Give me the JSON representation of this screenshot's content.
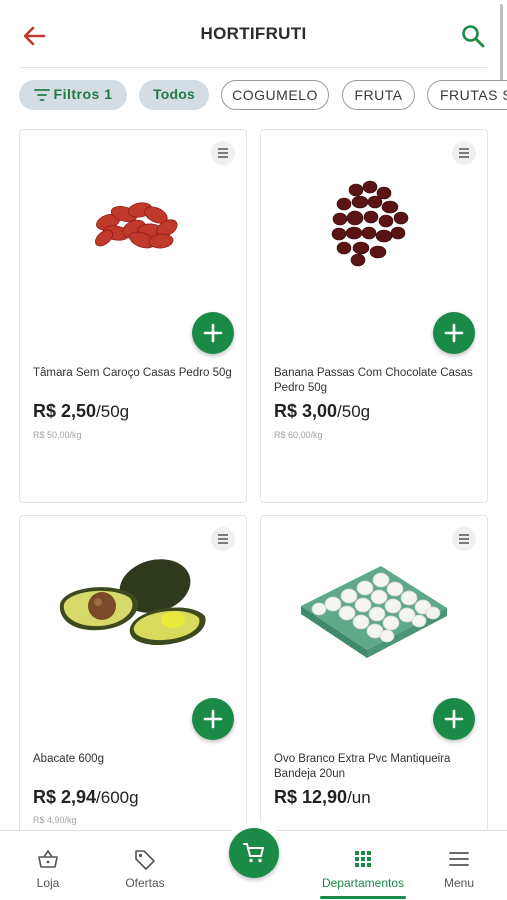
{
  "header": {
    "title": "HORTIFRUTI",
    "back_icon": "arrow-left-icon",
    "search_icon": "search-icon"
  },
  "filters": {
    "filter_label": "Filtros",
    "filter_count": "1",
    "chips": [
      "Todos",
      "COGUMELO",
      "FRUTA",
      "FRUTAS S"
    ]
  },
  "products": [
    {
      "name": "Tâmara Sem Caroço Casas Pedro 50g",
      "price": "R$ 2,50",
      "unit": "/50g",
      "unit_price": "R$ 50,00/kg",
      "image": "dates-image"
    },
    {
      "name": "Banana Passas Com Chocolate Casas Pedro 50g",
      "price": "R$ 3,00",
      "unit": "/50g",
      "unit_price": "R$ 60,00/kg",
      "image": "chocolate-banana-image"
    },
    {
      "name": "Abacate 600g",
      "price": "R$ 2,94",
      "unit": "/600g",
      "unit_price": "R$ 4,90/kg",
      "image": "avocado-image"
    },
    {
      "name": "Ovo Branco Extra Pvc Mantiqueira Bandeja 20un",
      "price": "R$ 12,90",
      "unit": "/un",
      "unit_price": "",
      "image": "eggs-tray-image"
    }
  ],
  "bottom_nav": {
    "items": [
      {
        "label": "Loja",
        "icon": "basket-icon"
      },
      {
        "label": "Ofertas",
        "icon": "tag-icon"
      },
      {
        "label": "Departamentos",
        "icon": "grid-icon",
        "active": true
      },
      {
        "label": "Menu",
        "icon": "hamburger-icon"
      }
    ],
    "cart_icon": "cart-icon"
  },
  "colors": {
    "brand_green": "#1a8a47",
    "back_arrow": "#c0392b",
    "chip_active_bg": "#d5dde4"
  }
}
